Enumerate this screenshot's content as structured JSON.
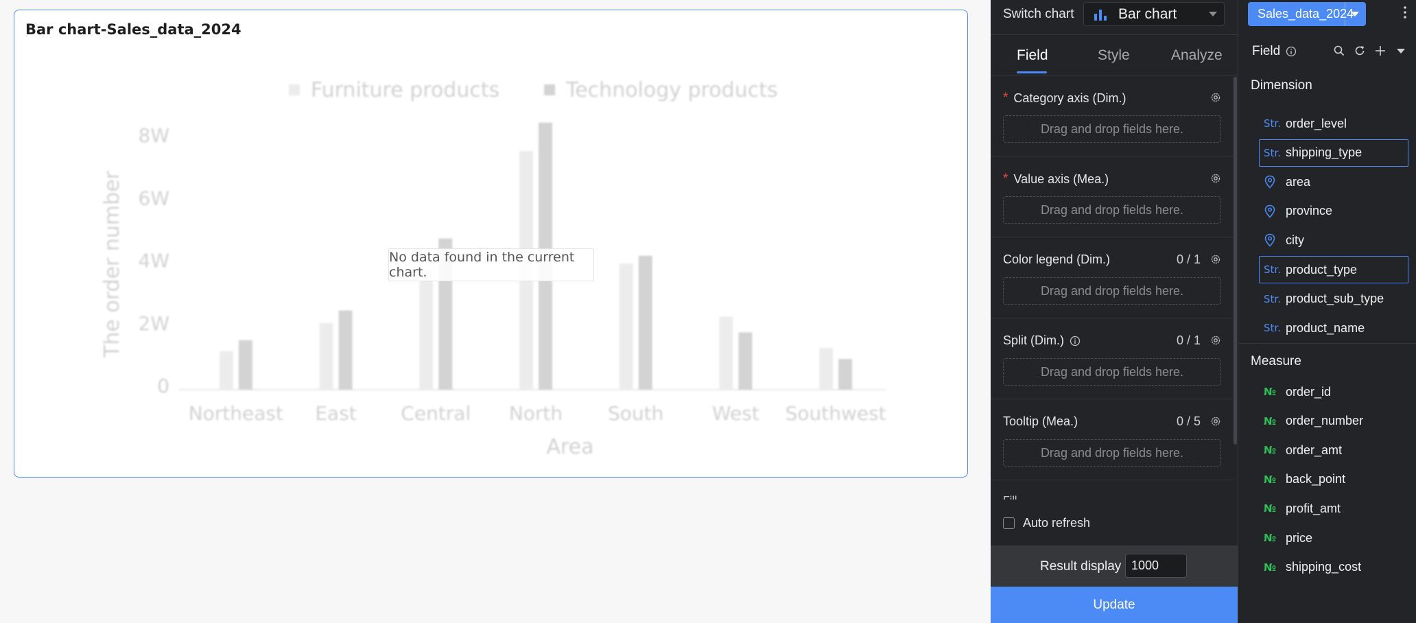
{
  "chart_card": {
    "title": "Bar chart-Sales_data_2024",
    "empty_message": "No data found in the current chart."
  },
  "chart_data": {
    "type": "bar",
    "categories": [
      "Northeast",
      "East",
      "Central",
      "North",
      "South",
      "West",
      "Southwest"
    ],
    "series": [
      {
        "name": "Furniture products",
        "values": [
          11000,
          20000,
          37000,
          75000,
          39000,
          22000,
          12000
        ]
      },
      {
        "name": "Technology products",
        "values": [
          14500,
          24000,
          47000,
          84000,
          41500,
          17000,
          8500
        ]
      }
    ],
    "yticks": [
      {
        "value": 0,
        "label": "0"
      },
      {
        "value": 20000,
        "label": "2W"
      },
      {
        "value": 40000,
        "label": "4W"
      },
      {
        "value": 60000,
        "label": "6W"
      },
      {
        "value": 80000,
        "label": "8W"
      }
    ],
    "ylim": [
      0,
      80000
    ],
    "xlabel": "Area",
    "ylabel": "The order number",
    "legend_position": "top-center",
    "colors": {
      "furniture": "#d6d6d6",
      "technology": "#9e9e9e"
    },
    "grid": false
  },
  "config": {
    "switch_label": "Switch chart",
    "chart_type": "Bar chart",
    "tabs": [
      {
        "label": "Field",
        "active": true
      },
      {
        "label": "Style",
        "active": false
      },
      {
        "label": "Analyze",
        "active": false
      }
    ],
    "sections": [
      {
        "label": "Category axis (Dim.)",
        "required": true,
        "count": "",
        "info": false,
        "placeholder": "Drag and drop fields here."
      },
      {
        "label": "Value axis (Mea.)",
        "required": true,
        "count": "",
        "info": false,
        "placeholder": "Drag and drop fields here."
      },
      {
        "label": "Color legend (Dim.)",
        "required": false,
        "count": "0 / 1",
        "info": false,
        "placeholder": "Drag and drop fields here."
      },
      {
        "label": "Split (Dim.)",
        "required": false,
        "count": "0 / 1",
        "info": true,
        "placeholder": "Drag and drop fields here."
      },
      {
        "label": "Tooltip (Mea.)",
        "required": false,
        "count": "0 / 5",
        "info": false,
        "placeholder": "Drag and drop fields here."
      }
    ],
    "partial_section_label": "Fill",
    "auto_refresh_label": "Auto refresh",
    "result_display_label": "Result display",
    "result_display_value": "1000",
    "update_label": "Update"
  },
  "fields_panel": {
    "dataset": "Sales_data_2024",
    "header_label": "Field",
    "dimension_label": "Dimension",
    "measure_label": "Measure",
    "str_badge": "Str.",
    "num_badge": "№",
    "dimensions": [
      {
        "name": "order_level",
        "type": "str",
        "selected": false
      },
      {
        "name": "shipping_type",
        "type": "str",
        "selected": true
      },
      {
        "name": "area",
        "type": "geo",
        "selected": false
      },
      {
        "name": "province",
        "type": "geo",
        "selected": false
      },
      {
        "name": "city",
        "type": "geo",
        "selected": false
      },
      {
        "name": "product_type",
        "type": "str",
        "selected": true
      },
      {
        "name": "product_sub_type",
        "type": "str",
        "selected": false
      },
      {
        "name": "product_name",
        "type": "str",
        "selected": false
      }
    ],
    "measures": [
      {
        "name": "order_id",
        "type": "num"
      },
      {
        "name": "order_number",
        "type": "num"
      },
      {
        "name": "order_amt",
        "type": "num"
      },
      {
        "name": "back_point",
        "type": "num"
      },
      {
        "name": "profit_amt",
        "type": "num"
      },
      {
        "name": "price",
        "type": "num"
      },
      {
        "name": "shipping_cost",
        "type": "num"
      }
    ]
  },
  "colors": {
    "accent": "#4c8bf5",
    "panel_bg": "#232427",
    "required": "#e5483d",
    "measure_badge": "#32c05a"
  }
}
